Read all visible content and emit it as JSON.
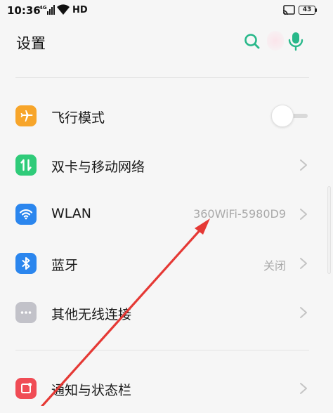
{
  "status_bar": {
    "time": "10:36",
    "network": "HD",
    "battery": "43"
  },
  "header": {
    "title": "设置",
    "search_icon": "search-icon",
    "voice_icon": "microphone-icon"
  },
  "rows": [
    {
      "label": "飞行模式",
      "icon": "airplane-icon",
      "icon_color": "#f7a52a",
      "control": "toggle",
      "toggle_on": false
    },
    {
      "label": "双卡与移动网络",
      "icon": "dual-sim-arrows-icon",
      "icon_color": "#2fcb79",
      "control": "chevron"
    },
    {
      "label": "WLAN",
      "icon": "wifi-icon",
      "icon_color": "#2b86ee",
      "value": "360WiFi-5980D9",
      "control": "chevron"
    },
    {
      "label": "蓝牙",
      "icon": "bluetooth-icon",
      "icon_color": "#2b86ee",
      "value": "关闭",
      "control": "chevron"
    },
    {
      "label": "其他无线连接",
      "icon": "more-dots-icon",
      "icon_color": "#c2c2c9",
      "control": "chevron"
    },
    {
      "label": "通知与状态栏",
      "icon": "notification-icon",
      "icon_color": "#f04c55",
      "control": "chevron"
    }
  ],
  "colors": {
    "accent_green": "#28b88a",
    "annotation_arrow": "#e53935"
  }
}
